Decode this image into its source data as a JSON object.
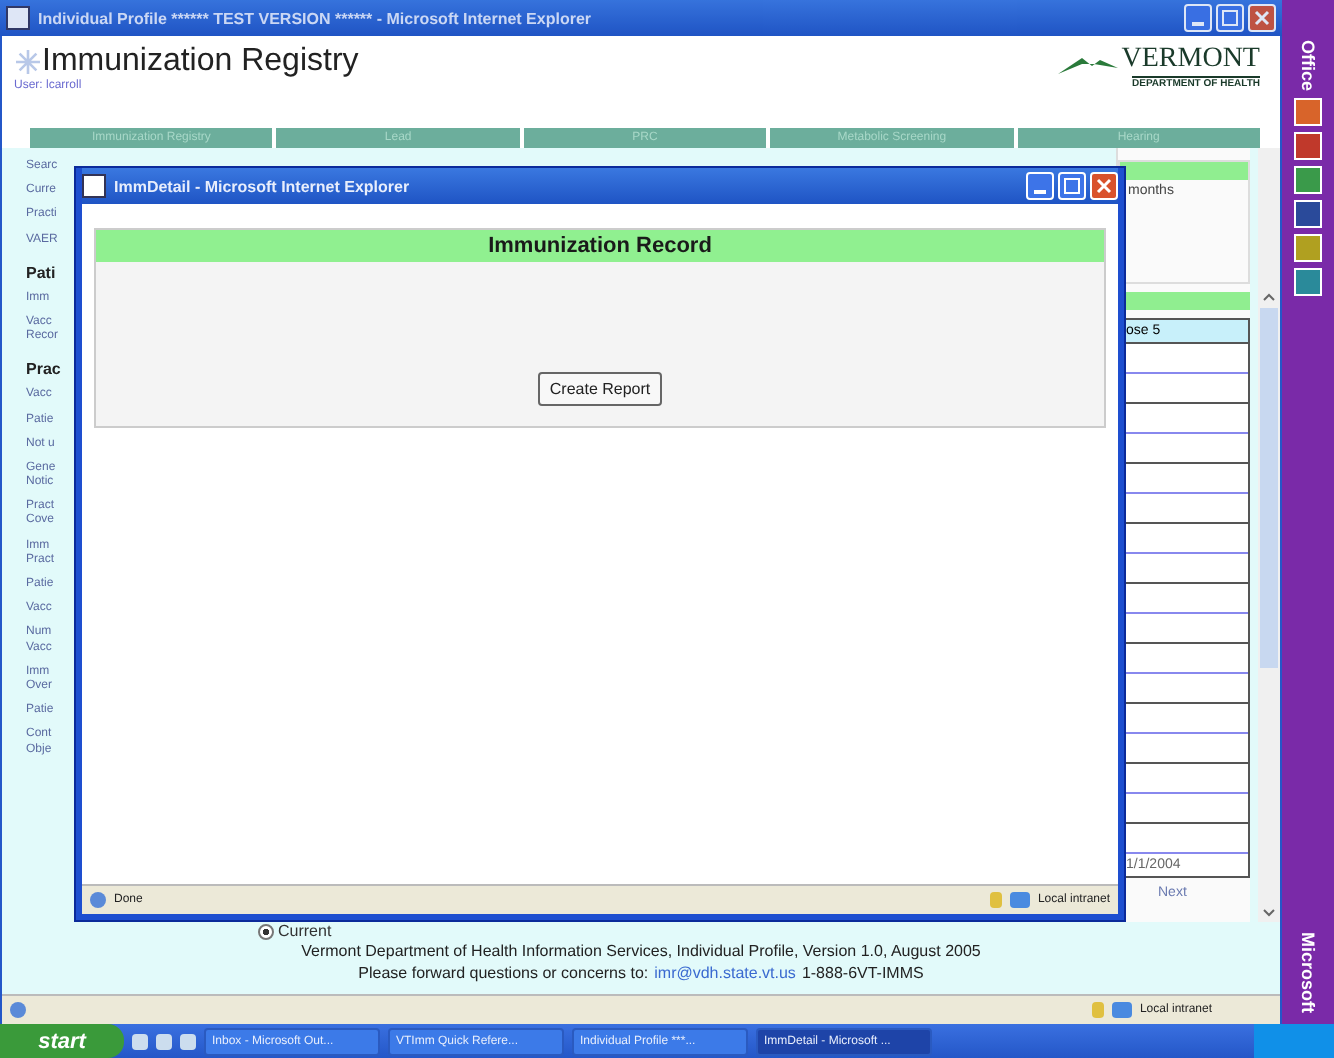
{
  "window": {
    "title": "Individual Profile ****** TEST VERSION ****** - Microsoft Internet Explorer"
  },
  "header": {
    "title": "Immunization Registry",
    "user": "User: lcarroll",
    "logo_name": "VERMONT",
    "logo_sub": "DEPARTMENT OF HEALTH"
  },
  "nav": [
    "Immunization Registry",
    "Lead",
    "PRC",
    "Metabolic Screening",
    "Hearing"
  ],
  "sidebar": {
    "items": [
      {
        "kind": "link",
        "text": "Searc"
      },
      {
        "kind": "link",
        "text": "Curre"
      },
      {
        "kind": "link",
        "text": "Practi"
      },
      {
        "kind": "link",
        "text": "VAER"
      },
      {
        "kind": "heading",
        "text": "Pati"
      },
      {
        "kind": "link",
        "text": "Imm"
      },
      {
        "kind": "link",
        "text": "Vacc\nRecor"
      },
      {
        "kind": "heading",
        "text": "Prac"
      },
      {
        "kind": "link",
        "text": "Vacc"
      },
      {
        "kind": "link",
        "text": "Patie"
      },
      {
        "kind": "link",
        "text": "Not u"
      },
      {
        "kind": "link",
        "text": "Gene\nNotic"
      },
      {
        "kind": "link",
        "text": "Pract\nCove"
      },
      {
        "kind": "link",
        "text": "Imm\nPract"
      },
      {
        "kind": "link",
        "text": "Patie"
      },
      {
        "kind": "link",
        "text": "Vacc"
      },
      {
        "kind": "link",
        "text": "Num\nVacc"
      },
      {
        "kind": "link",
        "text": "Imm\nOver"
      },
      {
        "kind": "link",
        "text": "Patie"
      },
      {
        "kind": "link",
        "text": "Cont\nObje"
      }
    ]
  },
  "right_panel": {
    "top_text": "months",
    "table_header": "ose 5",
    "last_cell": "1/1/2004",
    "next_link": "Next"
  },
  "footer": {
    "radio": {
      "label": "Current",
      "selected": true
    },
    "line1": "Vermont Department of Health Information Services, Individual Profile, Version 1.0, August 2005",
    "line2_prefix": "Please forward questions or concerns to:",
    "email": "imr@vdh.state.vt.us",
    "phone": "1-888-6VT-IMMS"
  },
  "status_bar": {
    "zone": "Local intranet"
  },
  "popup": {
    "title": "ImmDetail - Microsoft Internet Explorer",
    "record_title": "Immunization Record",
    "button": "Create Report",
    "status": "Done",
    "zone": "Local intranet"
  },
  "office_bar": {
    "top": "Office",
    "bottom": "Microsoft"
  },
  "taskbar": {
    "start": "start",
    "tasks": [
      {
        "label": "Inbox - Microsoft Out...",
        "selected": false
      },
      {
        "label": "VTImm Quick Refere...",
        "selected": false
      },
      {
        "label": "Individual Profile ***...",
        "selected": false
      },
      {
        "label": "ImmDetail - Microsoft ...",
        "selected": true
      }
    ]
  }
}
